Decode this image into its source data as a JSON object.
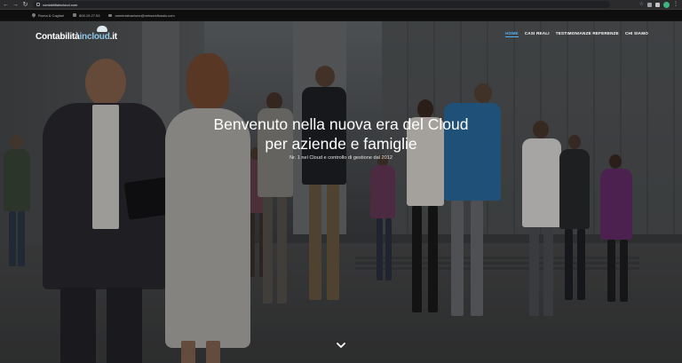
{
  "browser": {
    "url": "contabilitaincloud.com",
    "nav_back": "←",
    "nav_forward": "→",
    "nav_reload": "↻",
    "star": "☆",
    "menu": "⋮"
  },
  "contact_bar": {
    "location": "Roma & Cagliari",
    "phone": "800.19.27.53",
    "email": "amministrazione@networkficsalo.com"
  },
  "header": {
    "logo_main": "Contabilità",
    "logo_accent": "incloud",
    "logo_suffix": ".it",
    "nav": [
      {
        "label": "HOME",
        "active": true
      },
      {
        "label": "CASI REALI",
        "active": false
      },
      {
        "label": "TESTIMONIANZE REFERENZE",
        "active": false
      },
      {
        "label": "CHI SIAMO",
        "active": false
      }
    ]
  },
  "hero": {
    "title_line1": "Benvenuto nella nuova era del Cloud",
    "title_line2": "per aziende e famiglie",
    "subtitle": "Nr. 1 nel Cloud e controllo di gestione dal 2012",
    "scroll_icon": "chevron-down-icon"
  },
  "colors": {
    "accent": "#4fb4ff",
    "topbar": "#0e0e0e",
    "chrome": "#2b2b2d"
  }
}
